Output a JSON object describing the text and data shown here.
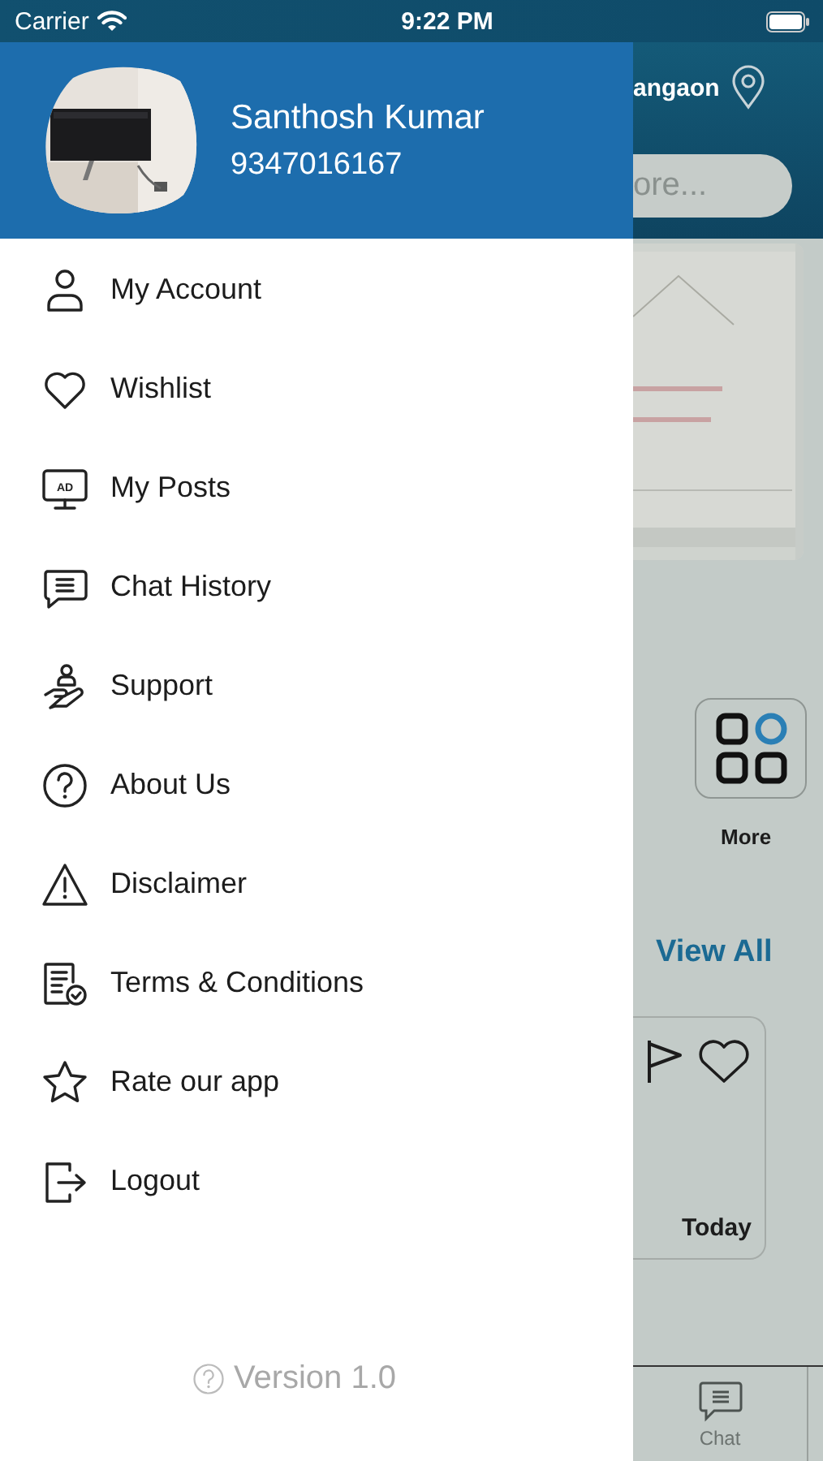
{
  "status_bar": {
    "carrier": "Carrier",
    "time": "9:22 PM"
  },
  "drawer": {
    "user_name": "Santhosh Kumar",
    "phone": "9347016167",
    "menu": [
      {
        "label": "My Account"
      },
      {
        "label": "Wishlist"
      },
      {
        "label": "My Posts",
        "icon_text": "AD"
      },
      {
        "label": "Chat History"
      },
      {
        "label": "Support"
      },
      {
        "label": "About Us"
      },
      {
        "label": "Disclaimer"
      },
      {
        "label": "Terms & Conditions"
      },
      {
        "label": "Rate our app"
      },
      {
        "label": "Logout"
      }
    ],
    "version": "Version 1.0"
  },
  "background": {
    "location": "angaon",
    "search": {
      "placeholder": "ore..."
    },
    "category": {
      "label": "More"
    },
    "section_link": "View All",
    "listing": {
      "date": "Today"
    },
    "tab_bar": [
      {
        "label": "Chat"
      }
    ]
  }
}
